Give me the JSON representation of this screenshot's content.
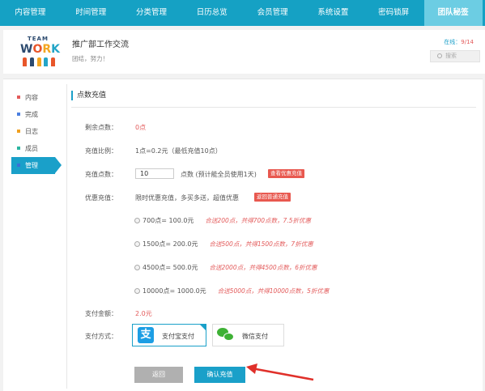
{
  "nav": {
    "items": [
      "内容管理",
      "时间管理",
      "分类管理",
      "日历总览",
      "会员管理",
      "系统设置",
      "密码锁屏",
      "团队秘签"
    ],
    "active_index": 7
  },
  "header": {
    "logo": {
      "top": "TEAM",
      "w": "W",
      "o": "O",
      "r": "R",
      "k": "K"
    },
    "title": "推广部工作交流",
    "subtitle": "团结，努力！",
    "online_label": "在线：",
    "online_value": "9/14",
    "search_placeholder": "搜索"
  },
  "sidebar": {
    "items": [
      {
        "label": "内容",
        "color": "#e35b5b"
      },
      {
        "label": "完成",
        "color": "#4a7fe0"
      },
      {
        "label": "日志",
        "color": "#f0a020"
      },
      {
        "label": "成员",
        "color": "#2bb5a0"
      },
      {
        "label": "管理",
        "color": "#3a70d6"
      }
    ],
    "active_index": 4
  },
  "recharge": {
    "section_title": "点数充值",
    "remaining_label": "剩余点数：",
    "remaining_value": "0点",
    "ratio_label": "充值比例：",
    "ratio_value": "1点=0.2元（最低充值10点）",
    "amount_label": "充值点数：",
    "amount_value": "10",
    "amount_hint": "点数 (预计能全员使用1天)",
    "amount_badge": "查看优惠充值",
    "promo_label": "优惠充值：",
    "promo_text": "限时优惠充值，多买多送，超值优惠",
    "promo_badge": "返回普通充值",
    "options": [
      {
        "text": "700点= 100.0元",
        "note": "合送200点，共得700点数，7.5折优惠"
      },
      {
        "text": "1500点= 200.0元",
        "note": "合送500点，共得1500点数，7折优惠"
      },
      {
        "text": "4500点= 500.0元",
        "note": "合送2000点，共得4500点数，6折优惠"
      },
      {
        "text": "10000点= 1000.0元",
        "note": "合送5000点，共得10000点数，5折优惠"
      }
    ],
    "total_label": "支付金额：",
    "total_value": "2.0元",
    "method_label": "支付方式：",
    "methods": [
      {
        "label": "支付宝支付",
        "icon": "alipay-icon",
        "selected": true
      },
      {
        "label": "微信支付",
        "icon": "wechat-icon",
        "selected": false
      }
    ],
    "back_button": "返回",
    "confirm_button": "确认充值"
  },
  "colors": {
    "accent": "#1aa0c9",
    "nav_bg": "#15a1c4",
    "warning": "#e35b5b",
    "arrow": "#e0302a"
  }
}
